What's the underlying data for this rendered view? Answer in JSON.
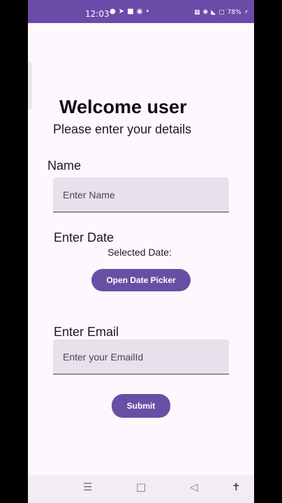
{
  "status_bar": {
    "time": "12:03",
    "battery": "78%",
    "icons_left": [
      "snapchat-icon",
      "telegram-icon",
      "app-icon",
      "notification-icon",
      "dot-icon"
    ],
    "icons_right": [
      "vibrate-icon",
      "bluetooth-icon",
      "wifi-icon",
      "data-icon",
      "battery-icon"
    ]
  },
  "form": {
    "title": "Welcome user",
    "subtitle": "Please enter your details",
    "name_label": "Name",
    "name_placeholder": "Enter Name",
    "date_label": "Enter Date",
    "selected_date_text": "Selected Date:",
    "date_picker_button": "Open Date Picker",
    "email_label": "Enter Email",
    "email_placeholder": "Enter your EmailId",
    "submit_button": "Submit"
  },
  "colors": {
    "accent": "#6750a4",
    "status_bar": "#6b4ba8",
    "background": "#fef7fe",
    "field_fill": "#e8e0eb"
  }
}
